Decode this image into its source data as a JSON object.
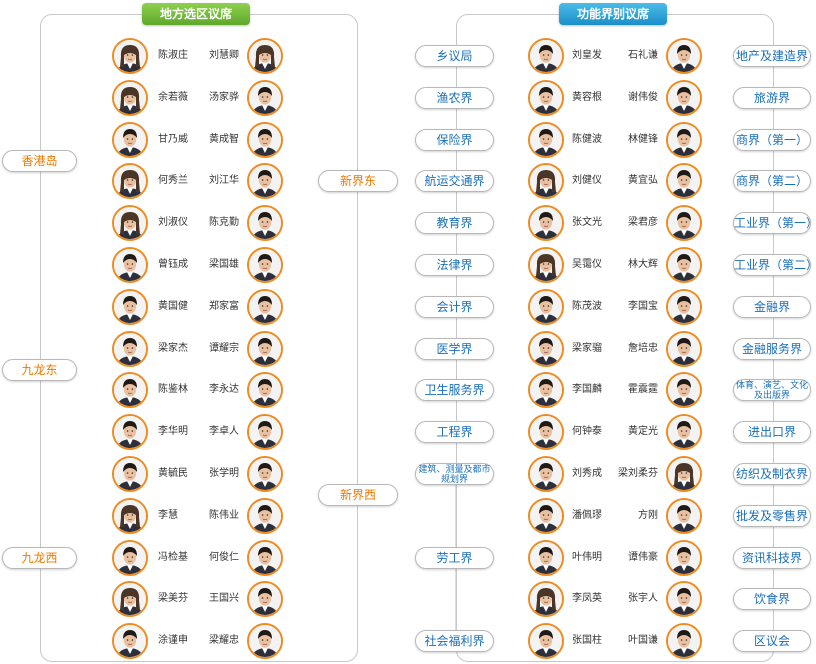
{
  "left_panel": {
    "title": "地方选区议席",
    "regions": [
      {
        "label": "香港岛",
        "side": "left"
      },
      {
        "label": "九龙东",
        "side": "left"
      },
      {
        "label": "九龙西",
        "side": "left"
      },
      {
        "label": "新界东",
        "side": "right"
      },
      {
        "label": "新界西",
        "side": "right"
      }
    ],
    "left_column": [
      {
        "name": "陈淑庄",
        "gender": "f"
      },
      {
        "name": "余若薇",
        "gender": "f"
      },
      {
        "name": "甘乃威",
        "gender": "m"
      },
      {
        "name": "何秀兰",
        "gender": "f"
      },
      {
        "name": "刘淑仪",
        "gender": "f"
      },
      {
        "name": "曾钰成",
        "gender": "m"
      },
      {
        "name": "黄国健",
        "gender": "m"
      },
      {
        "name": "梁家杰",
        "gender": "m"
      },
      {
        "name": "陈鉴林",
        "gender": "m"
      },
      {
        "name": "李华明",
        "gender": "m"
      },
      {
        "name": "黄毓民",
        "gender": "m"
      },
      {
        "name": "李慧",
        "gender": "f"
      },
      {
        "name": "冯检基",
        "gender": "m"
      },
      {
        "name": "梁美芬",
        "gender": "f"
      },
      {
        "name": "涂谨申",
        "gender": "m"
      }
    ],
    "right_column": [
      {
        "name": "刘慧卿",
        "gender": "f"
      },
      {
        "name": "汤家骅",
        "gender": "m"
      },
      {
        "name": "黄成智",
        "gender": "m"
      },
      {
        "name": "刘江华",
        "gender": "m"
      },
      {
        "name": "陈克勤",
        "gender": "m"
      },
      {
        "name": "梁国雄",
        "gender": "m"
      },
      {
        "name": "郑家富",
        "gender": "m"
      },
      {
        "name": "谭耀宗",
        "gender": "m"
      },
      {
        "name": "李永达",
        "gender": "m"
      },
      {
        "name": "李卓人",
        "gender": "m"
      },
      {
        "name": "张学明",
        "gender": "m"
      },
      {
        "name": "陈伟业",
        "gender": "m"
      },
      {
        "name": "何俊仁",
        "gender": "m"
      },
      {
        "name": "王国兴",
        "gender": "m"
      },
      {
        "name": "梁耀忠",
        "gender": "m"
      }
    ]
  },
  "right_panel": {
    "title": "功能界别议席",
    "rows": [
      {
        "left_sector": "乡议局",
        "left_name": "刘皇发",
        "left_gender": "m",
        "right_name": "石礼谦",
        "right_gender": "m",
        "right_sector": "地产及建造界"
      },
      {
        "left_sector": "渔农界",
        "left_name": "黄容根",
        "left_gender": "m",
        "right_name": "谢伟俊",
        "right_gender": "m",
        "right_sector": "旅游界"
      },
      {
        "left_sector": "保险界",
        "left_name": "陈健波",
        "left_gender": "m",
        "right_name": "林健锋",
        "right_gender": "m",
        "right_sector": "商界（第一）"
      },
      {
        "left_sector": "航运交通界",
        "left_name": "刘健仪",
        "left_gender": "f",
        "right_name": "黄宜弘",
        "right_gender": "m",
        "right_sector": "商界（第二）"
      },
      {
        "left_sector": "教育界",
        "left_name": "张文光",
        "left_gender": "m",
        "right_name": "梁君彦",
        "right_gender": "m",
        "right_sector": "工业界（第一）"
      },
      {
        "left_sector": "法律界",
        "left_name": "吴霭仪",
        "left_gender": "f",
        "right_name": "林大辉",
        "right_gender": "m",
        "right_sector": "工业界（第二）"
      },
      {
        "left_sector": "会计界",
        "left_name": "陈茂波",
        "left_gender": "m",
        "right_name": "李国宝",
        "right_gender": "m",
        "right_sector": "金融界"
      },
      {
        "left_sector": "医学界",
        "left_name": "梁家骝",
        "left_gender": "m",
        "right_name": "詹培忠",
        "right_gender": "m",
        "right_sector": "金融服务界"
      },
      {
        "left_sector": "卫生服务界",
        "left_name": "李国麟",
        "left_gender": "m",
        "right_name": "霍震霆",
        "right_gender": "m",
        "right_sector": "体育、演艺、文化及出版界"
      },
      {
        "left_sector": "工程界",
        "left_name": "何钟泰",
        "left_gender": "m",
        "right_name": "黄定光",
        "right_gender": "m",
        "right_sector": "进出口界"
      },
      {
        "left_sector": "建筑、测量及都市规划界",
        "left_name": "刘秀成",
        "left_gender": "m",
        "right_name": "梁刘柔芬",
        "right_gender": "f",
        "right_sector": "纺织及制衣界"
      },
      {
        "left_sector": "",
        "left_name": "潘佩璆",
        "left_gender": "m",
        "right_name": "方刚",
        "right_gender": "m",
        "right_sector": "批发及零售界"
      },
      {
        "left_sector": "劳工界",
        "left_name": "叶伟明",
        "left_gender": "m",
        "right_name": "谭伟豪",
        "right_gender": "m",
        "right_sector": "资讯科技界"
      },
      {
        "left_sector": "",
        "left_name": "李凤英",
        "left_gender": "f",
        "right_name": "张宇人",
        "right_gender": "m",
        "right_sector": "饮食界"
      },
      {
        "left_sector": "社会福利界",
        "left_name": "张国柱",
        "left_gender": "m",
        "right_name": "叶国谦",
        "right_gender": "m",
        "right_sector": "区议会"
      }
    ]
  },
  "colors": {
    "region_text": "#f07800",
    "sector_text": "#1a6fb8",
    "avatar_border": "#f08a1e",
    "line": "#bbbbbb"
  }
}
